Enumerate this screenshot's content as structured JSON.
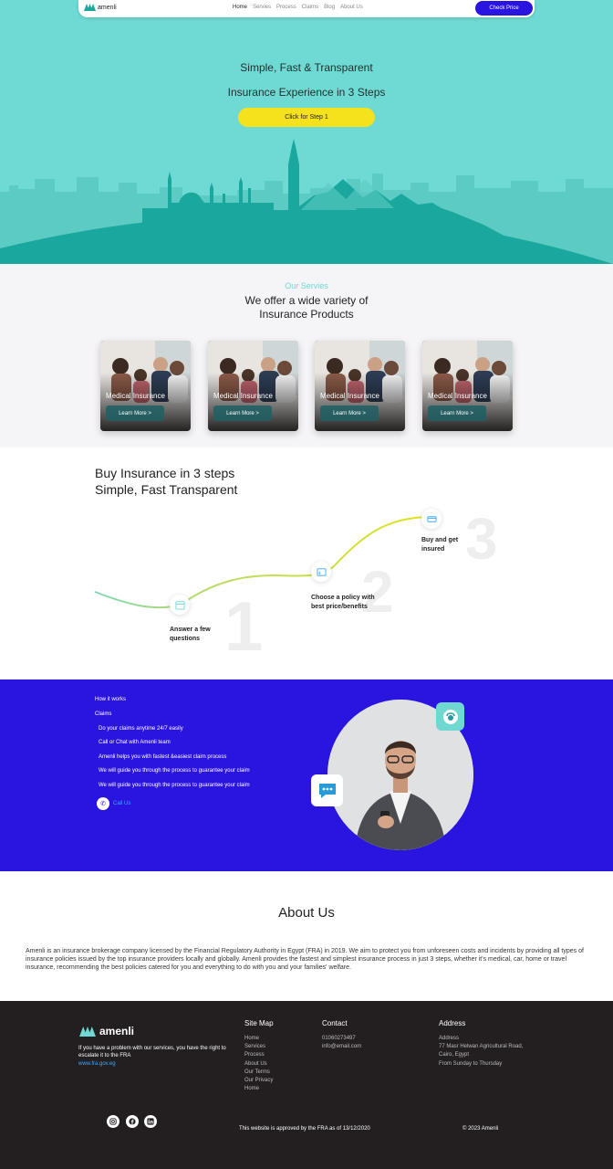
{
  "nav": {
    "logo_text": "amenli",
    "links": [
      "Home",
      "Servies",
      "Process",
      "Claims",
      "Blog",
      "About Us"
    ],
    "cta": "Check Price"
  },
  "hero": {
    "line1": "Simple, Fast & Transparent",
    "line2": "Insurance Experience in 3 Steps",
    "button": "Click for Step 1",
    "colors": {
      "background": "#6fdad3",
      "skyline": "#5ccbc3",
      "foreground": "#1aa89e",
      "button": "#f6e21c"
    }
  },
  "services": {
    "kicker": "Our Servies",
    "title_line1": "We offer a wide variety of",
    "title_line2": "Insurance Products",
    "cards": [
      {
        "label": "Medical Insurance",
        "button": "Learn More >"
      },
      {
        "label": "Medical Insurance",
        "button": "Learn More >"
      },
      {
        "label": "Medical Insurance",
        "button": "Learn More >"
      },
      {
        "label": "Medical Insurance",
        "button": "Learn More >"
      }
    ]
  },
  "steps": {
    "title_line1": "Buy Insurance in 3 steps",
    "title_line2": "Simple, Fast Transparent",
    "items": [
      {
        "number": "1",
        "line1": "Answer a few",
        "line2": "questions"
      },
      {
        "number": "2",
        "line1": "Choose a policy with",
        "line2": "best price/benefits"
      },
      {
        "number": "3",
        "line1": "Buy and get",
        "line2": "insured"
      }
    ]
  },
  "claims": {
    "how_it_works": "How it works",
    "title": "Claims",
    "items": [
      "Do your claims anytime 24/7 easily",
      "Call or Chat with Amenli team",
      "Amenli helps you with fastest &easiest claim process",
      "We will guide you through the process to guarantee your claim",
      "We will guide you through the process to guarantee your claim"
    ],
    "call": "Call Us",
    "colors": {
      "background": "#2a14e0"
    }
  },
  "about": {
    "title": "About Us",
    "text": "Amenli is an insurance brokerage company licensed by the Financial Regulatory Authority in Egypt (FRA) in 2019. We aim to protect you from unforeseen costs and incidents by providing all types of insurance policies issued by the top insurance providers locally and globally. Amenli provides the fastest and simplest insurance process in just 3 steps, whether it's medical, car, home or travel insurance, recommending the best policies catered for you and everything to do with you and your families' welfare."
  },
  "footer": {
    "logo_text": "amenli",
    "description": "If you have a problem with our services, you have the right to escalate it to the FRA",
    "fra_link": "www.fra.gov.eg",
    "sitemap": {
      "title": "Site Map",
      "items": [
        "Home",
        "Services",
        "Process",
        "About Us",
        "Our Terms",
        "Our Privacy",
        "Home"
      ]
    },
    "contact": {
      "title": "Contact",
      "items": [
        "01060273497",
        "info@email.com"
      ]
    },
    "address": {
      "title": "Address",
      "items": [
        "Address",
        "77 Masr Helwan Agricultural Road,",
        "Cairo, Egypt",
        "From Sunday to Thursday"
      ]
    },
    "social": [
      "instagram-icon",
      "facebook-icon",
      "linkedin-icon"
    ],
    "approved": "This website is approved by the FRA as of 13/12/2020",
    "copyright": "© 2023 Amenli"
  }
}
